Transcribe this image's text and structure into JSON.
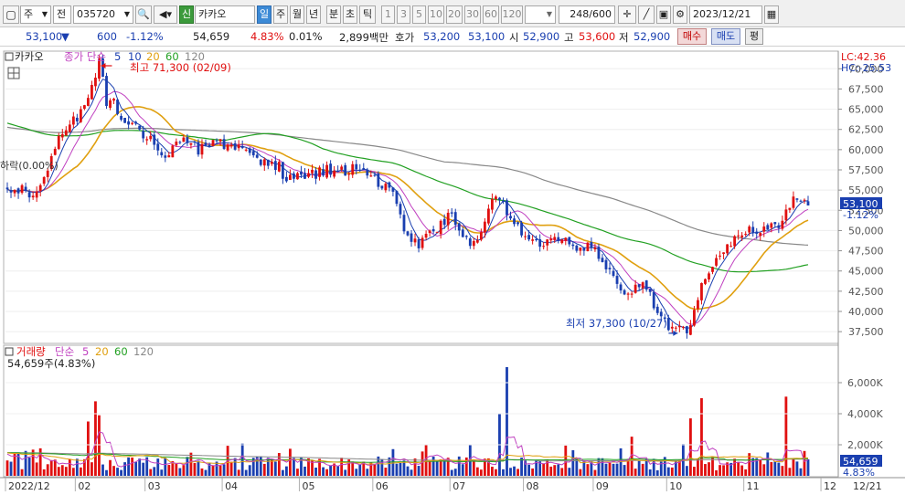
{
  "toolbar": {
    "market": "주",
    "period_unit": "전",
    "code": "035720",
    "credit_badge": "신",
    "name": "카카오",
    "periods": [
      "일",
      "주",
      "월",
      "년",
      "분",
      "초",
      "틱"
    ],
    "active_period": "일",
    "minute_buttons": [
      "1",
      "3",
      "5",
      "10",
      "20",
      "30",
      "60",
      "120"
    ],
    "count": "248/600",
    "date": "2023/12/21"
  },
  "quote": {
    "price": "53,100",
    "arrow": "▼",
    "change": "600",
    "change_pct": "-1.12%",
    "volume": "54,659",
    "vol_ratio": "4.83%",
    "turnover": "0.01%",
    "amount": "2,899백만",
    "hoga_label": "호가",
    "ask": "53,200",
    "bid": "53,100",
    "open_label": "시",
    "open": "52,900",
    "high_label": "고",
    "high": "53,600",
    "low_label": "저",
    "low": "52,900",
    "buy_label": "매수",
    "sell_label": "매도",
    "eval_label": "평"
  },
  "colors": {
    "up": "#e01010",
    "down": "#1a3fb0",
    "ma5": "#1a3fb0",
    "ma10": "#c040c0",
    "ma20": "#e0a010",
    "ma60": "#22a022",
    "ma120": "#888888"
  },
  "price_panel": {
    "legend": {
      "name": "카카오",
      "price_label": "종가 단순",
      "p5": "5",
      "p10": "10",
      "p20": "20",
      "p60": "60",
      "p120": "120"
    },
    "high_label": "최고 71,300 (02/09)",
    "low_label": "최저 37,300 (10/27)",
    "left_clip_label": "하락(0.00%)",
    "lc_label": "LC:42.36",
    "hc_label": "HC:-25.53",
    "current_price_label": "53,100",
    "current_change_label": "-1.12%",
    "y_ticks": [
      "70,000",
      "67,500",
      "65,000",
      "62,500",
      "60,000",
      "57,500",
      "55,000",
      "52,500",
      "50,000",
      "47,500",
      "45,000",
      "42,500",
      "40,000",
      "37,500"
    ]
  },
  "volume_panel": {
    "legend": {
      "name": "거래량",
      "type": "단순",
      "p5": "5",
      "p20": "20",
      "p60": "60",
      "p120": "120"
    },
    "value_label": "54,659주(4.83%)",
    "y_ticks": [
      "6,000K",
      "4,000K",
      "2,000K"
    ],
    "current_label": "54,659",
    "current_pct": "4.83%"
  },
  "x_axis": {
    "labels": [
      "2022/12",
      "02",
      "03",
      "04",
      "05",
      "06",
      "07",
      "08",
      "09",
      "10",
      "11",
      "12",
      "12/21"
    ]
  },
  "chart_data": {
    "type": "candlestick",
    "ylim": [
      36500,
      71500
    ],
    "anchors": [
      [
        0,
        55500
      ],
      [
        4,
        55000
      ],
      [
        7,
        54000
      ],
      [
        9,
        56000
      ],
      [
        13,
        60000
      ],
      [
        16,
        63000
      ],
      [
        19,
        64000
      ],
      [
        22,
        66000
      ],
      [
        24,
        69000
      ],
      [
        25,
        71000
      ],
      [
        27,
        66000
      ],
      [
        29,
        66000
      ],
      [
        31,
        64000
      ],
      [
        33,
        63000
      ],
      [
        36,
        62500
      ],
      [
        40,
        61000
      ],
      [
        43,
        58500
      ],
      [
        46,
        61500
      ],
      [
        49,
        61000
      ],
      [
        52,
        60000
      ],
      [
        55,
        60500
      ],
      [
        58,
        61000
      ],
      [
        61,
        60500
      ],
      [
        64,
        60000
      ],
      [
        66,
        59500
      ],
      [
        69,
        58500
      ],
      [
        71,
        58500
      ],
      [
        74,
        58000
      ],
      [
        76,
        56000
      ],
      [
        79,
        57500
      ],
      [
        81,
        56500
      ],
      [
        84,
        57000
      ],
      [
        87,
        57500
      ],
      [
        90,
        57500
      ],
      [
        93,
        57500
      ],
      [
        96,
        58000
      ],
      [
        99,
        57000
      ],
      [
        101,
        56000
      ],
      [
        104,
        55500
      ],
      [
        106,
        53500
      ],
      [
        108,
        50000
      ],
      [
        111,
        48500
      ],
      [
        113,
        48500
      ],
      [
        116,
        50000
      ],
      [
        118,
        51000
      ],
      [
        121,
        52000
      ],
      [
        123,
        50000
      ],
      [
        126,
        48000
      ],
      [
        129,
        50000
      ],
      [
        132,
        54000
      ],
      [
        135,
        53000
      ],
      [
        138,
        51500
      ],
      [
        140,
        50000
      ],
      [
        143,
        48500
      ],
      [
        146,
        48500
      ],
      [
        149,
        48500
      ],
      [
        152,
        48500
      ],
      [
        155,
        48000
      ],
      [
        158,
        48000
      ],
      [
        161,
        47000
      ],
      [
        163,
        45000
      ],
      [
        166,
        43500
      ],
      [
        168,
        41500
      ],
      [
        171,
        43000
      ],
      [
        173,
        43000
      ],
      [
        175,
        42000
      ],
      [
        178,
        39000
      ],
      [
        181,
        38000
      ],
      [
        183,
        37800
      ],
      [
        186,
        38000
      ],
      [
        188,
        42000
      ],
      [
        191,
        45000
      ],
      [
        193,
        46500
      ],
      [
        196,
        48000
      ],
      [
        198,
        49500
      ],
      [
        201,
        50000
      ],
      [
        204,
        50000
      ],
      [
        206,
        50500
      ],
      [
        209,
        50500
      ],
      [
        211,
        51000
      ],
      [
        214,
        54000
      ],
      [
        216,
        53500
      ],
      [
        218,
        53100
      ]
    ],
    "volume_ylim": [
      0,
      7000
    ],
    "volume_unit": "K"
  }
}
